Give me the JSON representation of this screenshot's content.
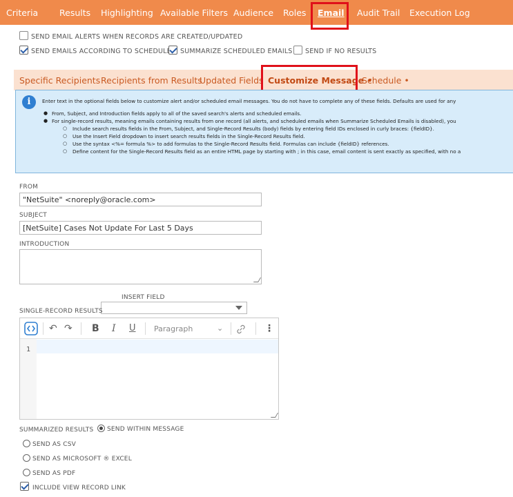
{
  "top_tabs": [
    {
      "label": "Criteria"
    },
    {
      "label": "Results"
    },
    {
      "label": "Highlighting"
    },
    {
      "label": "Available Filters"
    },
    {
      "label": "Audience"
    },
    {
      "label": "Roles"
    },
    {
      "label": "Email"
    },
    {
      "label": "Audit Trail"
    },
    {
      "label": "Execution Log"
    }
  ],
  "options": {
    "send_alerts": {
      "label": "SEND EMAIL ALERTS WHEN RECORDS ARE CREATED/UPDATED",
      "checked": false
    },
    "send_schedule": {
      "label": "SEND EMAILS ACCORDING TO SCHEDULE",
      "checked": true
    },
    "summarize": {
      "label": "SUMMARIZE SCHEDULED EMAILS",
      "checked": true
    },
    "no_results": {
      "label": "SEND IF NO RESULTS",
      "checked": false
    }
  },
  "sub_tabs": [
    {
      "label": "Specific Recipients"
    },
    {
      "label": "Recipients from Results"
    },
    {
      "label": "Updated Fields"
    },
    {
      "label": "Customize Message •"
    },
    {
      "label": "Schedule •"
    }
  ],
  "info": {
    "icon": "info-icon",
    "intro": "Enter text in the optional fields below to customize alert and/or scheduled email messages. You do not have to complete any of these fields. Defaults are used for any",
    "bullets": [
      "From, Subject, and Introduction fields apply to all of the saved search's alerts and scheduled emails.",
      "For single-record results, meaning emails containing results from one record (all alerts, and scheduled emails when Summarize Scheduled Emails is disabled), you"
    ],
    "sub_bullets": [
      "Include search results fields in the From, Subject, and Single-Record Results (body) fields by entering field IDs enclosed in curly braces: {fieldID}.",
      "Use the Insert Field dropdown to insert search results fields in the Single-Record Results field.",
      "Use the syntax <%= formula %> to add formulas to the Single-Record Results field. Formulas can include {fieldID} references.",
      "Define content for the Single-Record Results field as an entire HTML page by starting with ; in this case, email content is sent exactly as specified, with no a"
    ]
  },
  "form": {
    "from_label": "FROM",
    "from_value": "\"NetSuite\" <noreply@oracle.com>",
    "subject_label": "SUBJECT",
    "subject_value": "[NetSuite] Cases Not Update For Last 5 Days",
    "intro_label": "INTRODUCTION",
    "insert_field_label": "INSERT FIELD",
    "single_label": "SINGLE-RECORD RESULTS",
    "paragraph": "Paragraph",
    "line_number": "1",
    "summarized_label": "SUMMARIZED RESULTS",
    "send_within": "SEND WITHIN MESSAGE",
    "send_csv": "SEND AS CSV",
    "send_excel": "SEND AS MICROSOFT ® EXCEL",
    "send_pdf": "SEND AS PDF",
    "include_link": "INCLUDE VIEW RECORD LINK"
  },
  "colors": {
    "tab_bar": "#f08a4b",
    "subtab_bar": "#fbe1d0",
    "info_bg": "#d8ecfa",
    "highlight": "#e0101a"
  }
}
